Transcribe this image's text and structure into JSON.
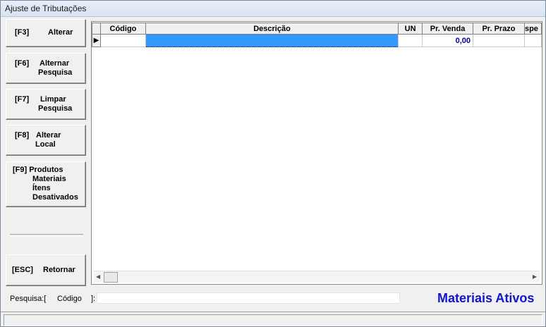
{
  "window": {
    "title": "Ajuste de Tributações"
  },
  "buttons": {
    "alterar": {
      "key": "[F3]",
      "label": "Alterar"
    },
    "alternar": {
      "key": "[F6]",
      "label_l1": "Alternar",
      "label_l2": "Pesquisa"
    },
    "limpar": {
      "key": "[F7]",
      "label_l1": "Limpar",
      "label_l2": "Pesquisa"
    },
    "local": {
      "key": "[F8]",
      "label_l1": "Alterar",
      "label_l2": "Local"
    },
    "produtos": {
      "line1": "[F9] Produtos",
      "line2": "Materiais",
      "line3": "Ítens",
      "line4": "Desativados"
    },
    "retornar": {
      "key": "[ESC]",
      "label": "Retornar"
    }
  },
  "grid": {
    "columns": [
      "Código",
      "Descrição",
      "UN",
      "Pr. Venda",
      "Pr. Prazo",
      "spe"
    ],
    "row": {
      "codigo": "",
      "descricao": "",
      "un": "",
      "pr_venda": "0,00",
      "pr_prazo": "",
      "spe": ""
    }
  },
  "search": {
    "prefix": "Pesquisa:[",
    "field": "Código",
    "suffix": "]:",
    "value": ""
  },
  "mode_label": "Materiais Ativos",
  "colors": {
    "selected_cell": "#3399ff",
    "value_text": "#00008b",
    "mode_label": "#1414c8"
  }
}
